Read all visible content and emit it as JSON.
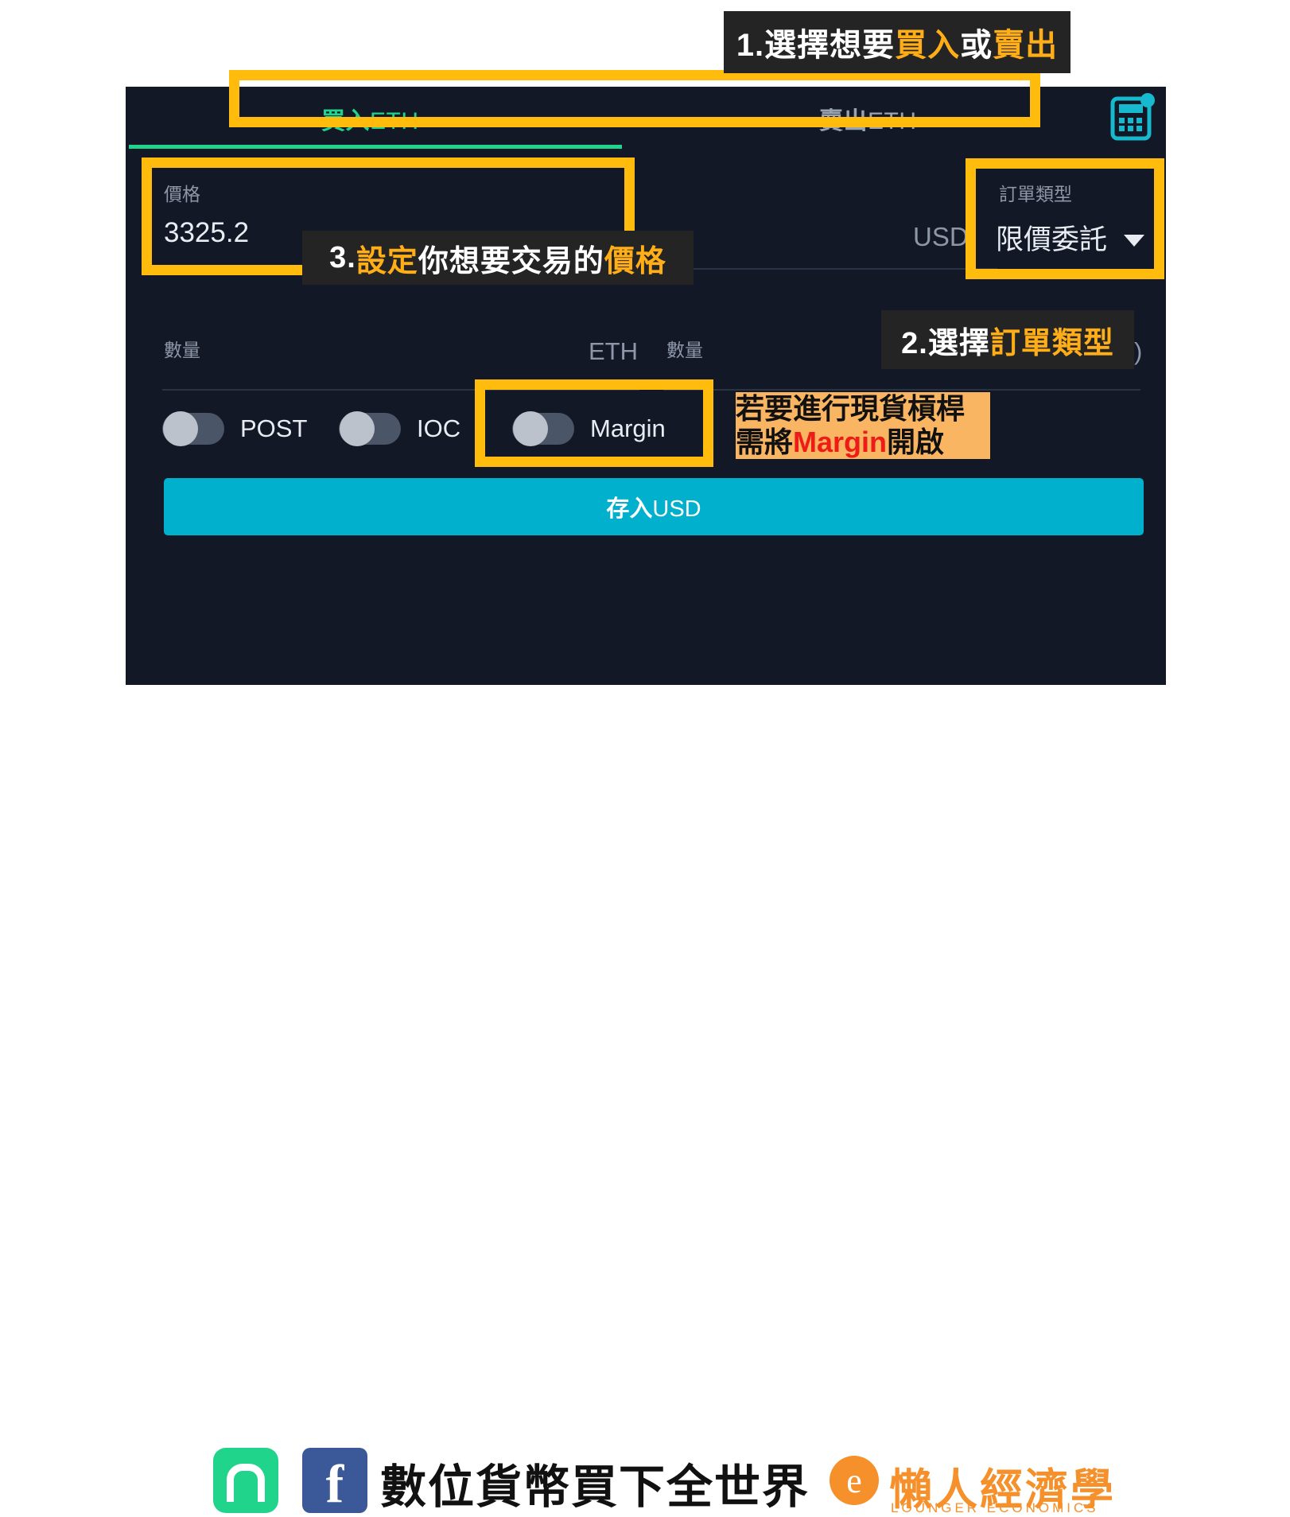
{
  "panel": {
    "tabs": [
      {
        "id": "buy",
        "cjk": "買入",
        "asset": "ETH",
        "label": "買入 ETH",
        "active": true,
        "color": "#21d48b"
      },
      {
        "id": "sell",
        "cjk": "賣出",
        "asset": "ETH",
        "label": "賣出 ETH",
        "active": false,
        "color": "#9aa3b0"
      }
    ],
    "calculator_icon": "calculator-icon",
    "price": {
      "label": "價格",
      "value": "3325.2",
      "unit": "USD"
    },
    "order_type": {
      "label": "訂單類型",
      "value": "限價委託",
      "caret": "chevron-down-icon"
    },
    "amount_left": {
      "label": "數量",
      "unit": "ETH",
      "value": ""
    },
    "amount_right": {
      "label": "數量",
      "unit": ")",
      "value": ""
    },
    "toggles": [
      {
        "id": "post",
        "label": "POST",
        "on": false
      },
      {
        "id": "ioc",
        "label": "IOC",
        "on": false
      },
      {
        "id": "margin",
        "label": "Margin",
        "on": false
      }
    ],
    "deposit_button": {
      "cjk": "存入",
      "currency": "USD",
      "label": "存入USD"
    }
  },
  "annotations": {
    "note1": {
      "prefix": "1.選擇想要",
      "hl1": "買入",
      "mid": "或",
      "hl2": "賣出"
    },
    "note2": {
      "prefix": "2.選擇",
      "hl1": "訂單類型"
    },
    "note3": {
      "prefix": "3.",
      "hl1": "設定",
      "mid": "你想要交易的",
      "hl2": "價格"
    },
    "note4": {
      "line1": "若要進行現貨槓桿",
      "line2_a": "需將",
      "line2_red": "Margin",
      "line2_b": "開啟"
    }
  },
  "footer": {
    "app_logo": "app-logo-icon",
    "facebook_logo": "facebook-icon",
    "facebook_glyph": "f",
    "title": "數位貨幣買下全世界",
    "brand_mark": "e",
    "brand_name": "懶人經濟學",
    "brand_sub": "LOUNGER ECONOMICS"
  },
  "colors": {
    "panel_bg": "#131826",
    "accent_green": "#21d48b",
    "accent_cyan": "#00b0cc",
    "callout_yellow": "#FFBC0D",
    "note_bg": "#242424",
    "note_highlight": "#FFAE17",
    "orange_note_bg": "#F9B562",
    "red": "#ED1C16",
    "brand_orange": "#F5902B",
    "facebook_blue": "#3b5998"
  }
}
